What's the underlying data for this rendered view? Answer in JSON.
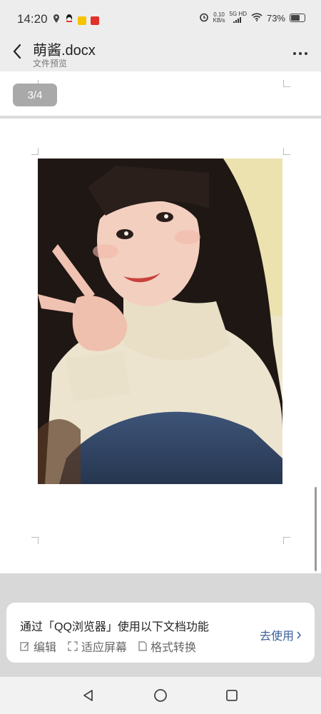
{
  "status": {
    "time": "14:20",
    "speed_top": "0.10",
    "speed_unit": "KB/s",
    "network": "5G HD",
    "battery": "73%",
    "battery_level": 0.73
  },
  "header": {
    "title": "萌酱.docx",
    "subtitle": "文件预览"
  },
  "doc": {
    "page_indicator": "3/4"
  },
  "promo": {
    "text": "通过「QQ浏览器」使用以下文档功能",
    "features": [
      "编辑",
      "适应屏幕",
      "格式转换"
    ],
    "cta": "去使用"
  },
  "colors": {
    "accent": "#3a5f9c"
  },
  "icons": {
    "back": "back-arrow-icon",
    "more": "more-dots-icon",
    "edit": "edit-icon",
    "fit": "fit-screen-icon",
    "format": "document-icon"
  }
}
